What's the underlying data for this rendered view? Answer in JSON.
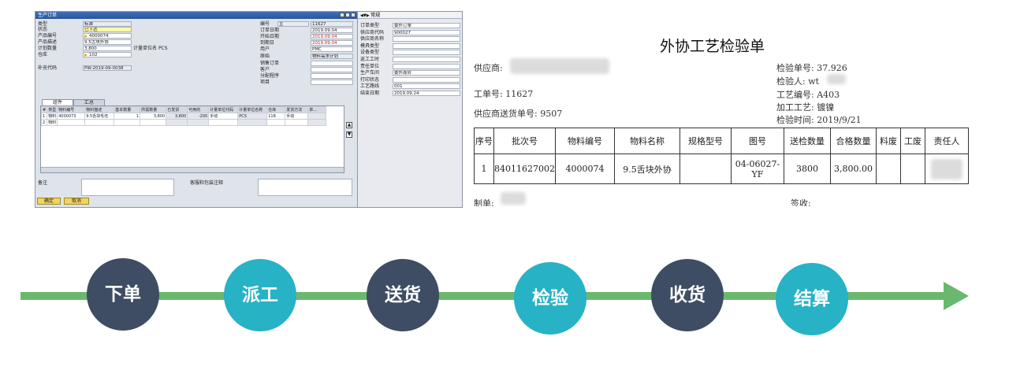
{
  "sap": {
    "title": "生产订单",
    "left_labels": [
      "类型",
      "状态",
      "产品编号",
      "产品描述",
      "计划数量",
      "仓库",
      "补充代码"
    ],
    "type": "标准",
    "status": "已下达",
    "product_no": "4000074",
    "product_desc": "9.5舌块外协",
    "planned_qty": "3,800",
    "unit_label": "计量单位名",
    "unit": "PCS",
    "warehouse": "102",
    "supp_code": "PW-2019-09-0038",
    "right_labels": [
      "编号",
      "订单日期",
      "开始日期",
      "到期日",
      "用户",
      "原始",
      "销售订单",
      "客户",
      "分配程序",
      "项目"
    ],
    "no_prefix": "主",
    "no": "11627",
    "order_date": "2019.09.04",
    "start_date": "2019.09.04",
    "due_date": "2019.09.04",
    "user": "PMC",
    "origin": "物料需求计划",
    "tabs": [
      "组件",
      "汇总"
    ],
    "grid_headers": [
      "#",
      "类型",
      "物料编号",
      "物料描述",
      "基本数量",
      "所需数量",
      "已发货",
      "可用的",
      "计量单位代码",
      "计量单位名称",
      "仓库",
      "发货方法",
      "单..."
    ],
    "grid_row1": [
      "1",
      "物料",
      "4000073",
      "9.5舌块毛坯",
      "1",
      "3,800",
      "3,800",
      "-200",
      "手动",
      "PCS",
      "118",
      "手动",
      ""
    ],
    "grid_row2": [
      "2",
      "物料",
      "",
      "",
      "",
      "",
      "",
      "",
      "",
      "",
      "",
      "",
      ""
    ],
    "remark_label": "备注",
    "pack_label": "客服和包装注释",
    "ok": "确定",
    "cancel": "取消"
  },
  "panel": {
    "header": "常规",
    "labels": [
      "订单类型",
      "供应商代码",
      "供应商名称",
      "模具类型",
      "设备类型",
      "返工工时",
      "责任单位",
      "生产车间",
      "打印状态",
      "工艺路线",
      "结束日期"
    ],
    "values": [
      "委外订单",
      "900027",
      "",
      "",
      "",
      "",
      "",
      "委外周转",
      "",
      "001",
      "2019.09.24"
    ]
  },
  "doc": {
    "title": "外协工艺检验单",
    "supplier_label": "供应商:",
    "work_order": "工单号: 11627",
    "delivery_no": "供应商送货单号: 9507",
    "inspection_no": "检验单号: 37.926",
    "inspector": "检验人: wt",
    "process_code": "工艺编号: A403",
    "process": "加工工艺: 镀镍",
    "inspect_time": "检验时间: 2019/9/21",
    "headers": [
      "序号",
      "批次号",
      "物料编号",
      "物料名称",
      "规格型号",
      "图号",
      "送检数量",
      "合格数量",
      "料废",
      "工废",
      "责任人"
    ],
    "row": [
      "1",
      "84011627002",
      "4000074",
      "9.5舌块外协",
      "",
      "04-06027-YF",
      "3800",
      "3,800.00",
      "",
      "",
      ""
    ],
    "made_by": "制单:",
    "sign": "签收:"
  },
  "steps": [
    {
      "label": "下单",
      "color": "#3e4d63"
    },
    {
      "label": "派工",
      "color": "#27b2c6"
    },
    {
      "label": "送货",
      "color": "#3e4d63"
    },
    {
      "label": "检验",
      "color": "#27b2c6"
    },
    {
      "label": "收货",
      "color": "#3e4d63"
    },
    {
      "label": "结算",
      "color": "#27b2c6"
    }
  ],
  "colors": {
    "line": "#6ab86d",
    "dark": "#3e4d63",
    "teal": "#27b2c6"
  }
}
